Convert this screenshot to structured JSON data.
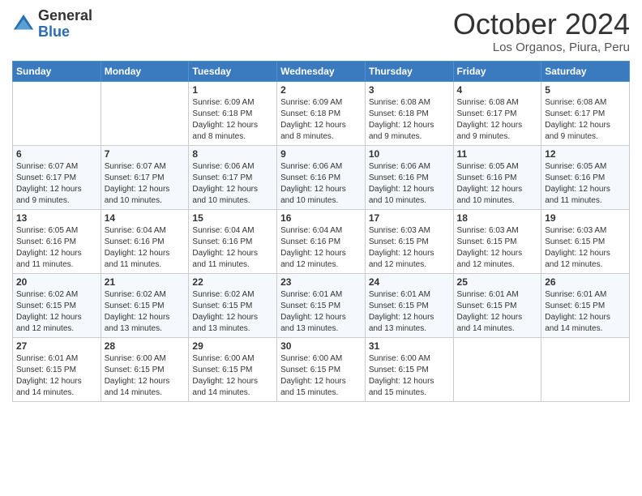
{
  "logo": {
    "general": "General",
    "blue": "Blue"
  },
  "title": "October 2024",
  "subtitle": "Los Organos, Piura, Peru",
  "weekdays": [
    "Sunday",
    "Monday",
    "Tuesday",
    "Wednesday",
    "Thursday",
    "Friday",
    "Saturday"
  ],
  "weeks": [
    [
      {
        "day": "",
        "info": ""
      },
      {
        "day": "",
        "info": ""
      },
      {
        "day": "1",
        "info": "Sunrise: 6:09 AM\nSunset: 6:18 PM\nDaylight: 12 hours\nand 8 minutes."
      },
      {
        "day": "2",
        "info": "Sunrise: 6:09 AM\nSunset: 6:18 PM\nDaylight: 12 hours\nand 8 minutes."
      },
      {
        "day": "3",
        "info": "Sunrise: 6:08 AM\nSunset: 6:18 PM\nDaylight: 12 hours\nand 9 minutes."
      },
      {
        "day": "4",
        "info": "Sunrise: 6:08 AM\nSunset: 6:17 PM\nDaylight: 12 hours\nand 9 minutes."
      },
      {
        "day": "5",
        "info": "Sunrise: 6:08 AM\nSunset: 6:17 PM\nDaylight: 12 hours\nand 9 minutes."
      }
    ],
    [
      {
        "day": "6",
        "info": "Sunrise: 6:07 AM\nSunset: 6:17 PM\nDaylight: 12 hours\nand 9 minutes."
      },
      {
        "day": "7",
        "info": "Sunrise: 6:07 AM\nSunset: 6:17 PM\nDaylight: 12 hours\nand 10 minutes."
      },
      {
        "day": "8",
        "info": "Sunrise: 6:06 AM\nSunset: 6:17 PM\nDaylight: 12 hours\nand 10 minutes."
      },
      {
        "day": "9",
        "info": "Sunrise: 6:06 AM\nSunset: 6:16 PM\nDaylight: 12 hours\nand 10 minutes."
      },
      {
        "day": "10",
        "info": "Sunrise: 6:06 AM\nSunset: 6:16 PM\nDaylight: 12 hours\nand 10 minutes."
      },
      {
        "day": "11",
        "info": "Sunrise: 6:05 AM\nSunset: 6:16 PM\nDaylight: 12 hours\nand 10 minutes."
      },
      {
        "day": "12",
        "info": "Sunrise: 6:05 AM\nSunset: 6:16 PM\nDaylight: 12 hours\nand 11 minutes."
      }
    ],
    [
      {
        "day": "13",
        "info": "Sunrise: 6:05 AM\nSunset: 6:16 PM\nDaylight: 12 hours\nand 11 minutes."
      },
      {
        "day": "14",
        "info": "Sunrise: 6:04 AM\nSunset: 6:16 PM\nDaylight: 12 hours\nand 11 minutes."
      },
      {
        "day": "15",
        "info": "Sunrise: 6:04 AM\nSunset: 6:16 PM\nDaylight: 12 hours\nand 11 minutes."
      },
      {
        "day": "16",
        "info": "Sunrise: 6:04 AM\nSunset: 6:16 PM\nDaylight: 12 hours\nand 12 minutes."
      },
      {
        "day": "17",
        "info": "Sunrise: 6:03 AM\nSunset: 6:15 PM\nDaylight: 12 hours\nand 12 minutes."
      },
      {
        "day": "18",
        "info": "Sunrise: 6:03 AM\nSunset: 6:15 PM\nDaylight: 12 hours\nand 12 minutes."
      },
      {
        "day": "19",
        "info": "Sunrise: 6:03 AM\nSunset: 6:15 PM\nDaylight: 12 hours\nand 12 minutes."
      }
    ],
    [
      {
        "day": "20",
        "info": "Sunrise: 6:02 AM\nSunset: 6:15 PM\nDaylight: 12 hours\nand 12 minutes."
      },
      {
        "day": "21",
        "info": "Sunrise: 6:02 AM\nSunset: 6:15 PM\nDaylight: 12 hours\nand 13 minutes."
      },
      {
        "day": "22",
        "info": "Sunrise: 6:02 AM\nSunset: 6:15 PM\nDaylight: 12 hours\nand 13 minutes."
      },
      {
        "day": "23",
        "info": "Sunrise: 6:01 AM\nSunset: 6:15 PM\nDaylight: 12 hours\nand 13 minutes."
      },
      {
        "day": "24",
        "info": "Sunrise: 6:01 AM\nSunset: 6:15 PM\nDaylight: 12 hours\nand 13 minutes."
      },
      {
        "day": "25",
        "info": "Sunrise: 6:01 AM\nSunset: 6:15 PM\nDaylight: 12 hours\nand 14 minutes."
      },
      {
        "day": "26",
        "info": "Sunrise: 6:01 AM\nSunset: 6:15 PM\nDaylight: 12 hours\nand 14 minutes."
      }
    ],
    [
      {
        "day": "27",
        "info": "Sunrise: 6:01 AM\nSunset: 6:15 PM\nDaylight: 12 hours\nand 14 minutes."
      },
      {
        "day": "28",
        "info": "Sunrise: 6:00 AM\nSunset: 6:15 PM\nDaylight: 12 hours\nand 14 minutes."
      },
      {
        "day": "29",
        "info": "Sunrise: 6:00 AM\nSunset: 6:15 PM\nDaylight: 12 hours\nand 14 minutes."
      },
      {
        "day": "30",
        "info": "Sunrise: 6:00 AM\nSunset: 6:15 PM\nDaylight: 12 hours\nand 15 minutes."
      },
      {
        "day": "31",
        "info": "Sunrise: 6:00 AM\nSunset: 6:15 PM\nDaylight: 12 hours\nand 15 minutes."
      },
      {
        "day": "",
        "info": ""
      },
      {
        "day": "",
        "info": ""
      }
    ]
  ]
}
